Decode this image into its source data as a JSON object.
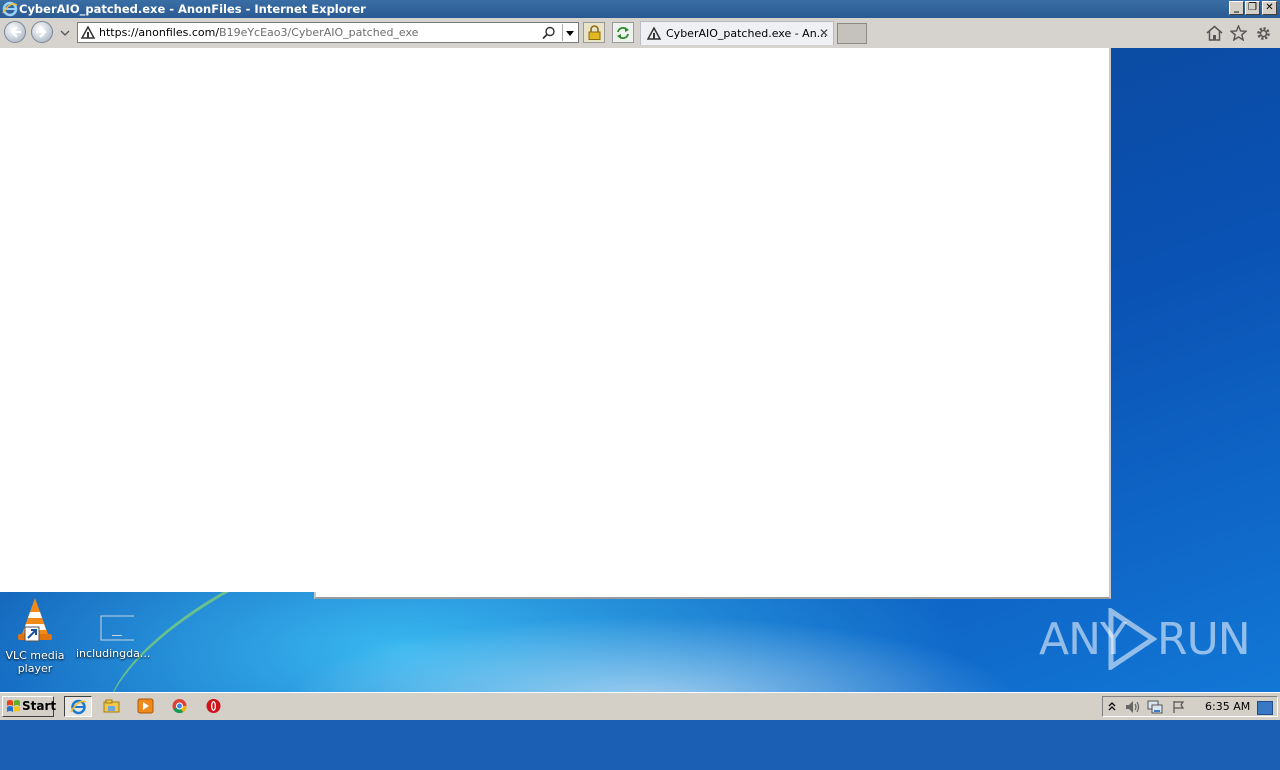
{
  "window": {
    "title": "CyberAIO_patched.exe - AnonFiles - Internet Explorer",
    "minimize_glyph": "_",
    "restore_glyph": "❐",
    "close_glyph": "✕"
  },
  "toolbar": {
    "url_host": "https://anonfiles.com/",
    "url_path": "B19eYcEao3/CyberAIO_patched_exe",
    "tab_label": "CyberAIO_patched.exe - An...",
    "tab_close_glyph": "✕",
    "icons": [
      "back-icon",
      "forward-icon",
      "site-icon",
      "search-icon",
      "lock-icon",
      "refresh-icon",
      "home-icon",
      "favorites-star-icon",
      "tools-gear-icon"
    ]
  },
  "desktop": {
    "icons": [
      {
        "label_line1": "VLC media",
        "label_line2": "player"
      },
      {
        "label_line1": "includingda...",
        "label_line2": ""
      }
    ],
    "watermark": {
      "left": "ANY",
      "right": "RUN"
    }
  },
  "taskbar": {
    "start_label": "Start",
    "apps": [
      "internet-explorer-icon",
      "file-explorer-icon",
      "media-player-icon",
      "chrome-icon",
      "opera-icon"
    ],
    "clock": "6:35 AM"
  },
  "colors": {
    "titlebar": "#2a5a92",
    "desktop": "#0b4aa0",
    "taskbar": "#d4d0c8"
  }
}
